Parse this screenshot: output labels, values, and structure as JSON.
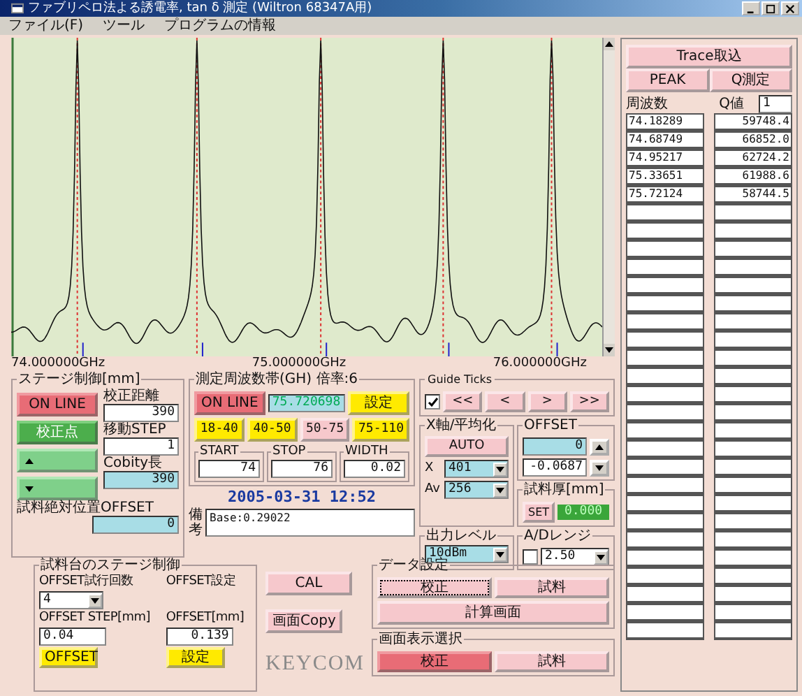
{
  "window": {
    "title": "ファブリペロ法よる誘電率, tan δ 測定 (Wiltron 68347A用)"
  },
  "menu": [
    "ファイル(F)",
    "ツール",
    "プログラムの情報"
  ],
  "chart": {
    "axis_labels": [
      "74.000000GHz",
      "75.000000GHz",
      "76.000000GHz"
    ]
  },
  "stage": {
    "title": "ステージ制御[mm]",
    "online_button": "ON LINE",
    "calib_button": "校正点",
    "fields": [
      {
        "label": "校正距離",
        "value": "390",
        "highlighted": false
      },
      {
        "label": "移動STEP",
        "value": "1",
        "highlighted": false
      },
      {
        "label": "Cobity長",
        "value": "390",
        "highlighted": true
      }
    ],
    "offset_label": "試料絶対位置OFFSET",
    "offset_value": "0"
  },
  "frequency": {
    "title": "測定周波数帯(GH) 倍率:6",
    "online_button": "ON LINE",
    "value": "75.720698",
    "set_button": "設定",
    "bands": [
      {
        "label": "18-40",
        "selected": false
      },
      {
        "label": "40-50",
        "selected": false
      },
      {
        "label": "50-75",
        "selected": true
      },
      {
        "label": "75-110",
        "selected": false
      }
    ],
    "ranges": [
      {
        "label": "START",
        "value": "74"
      },
      {
        "label": "STOP",
        "value": "76"
      },
      {
        "label": "WIDTH",
        "value": "0.02"
      }
    ]
  },
  "timestamp": "2005-03-31  12:52",
  "note": {
    "label": "備考",
    "value": "Base:0.29022"
  },
  "guide_ticks": {
    "title": "Guide Ticks",
    "checked": true,
    "buttons": [
      "<<",
      "<",
      ">",
      ">>"
    ]
  },
  "averaging": {
    "title": "X軸/平均化",
    "auto_button": "AUTO",
    "selects": [
      {
        "label": "X",
        "value": "401"
      },
      {
        "label": "Av",
        "value": "256"
      }
    ]
  },
  "offset": {
    "title": "OFFSET",
    "values": [
      "0",
      "-0.0687"
    ]
  },
  "thickness": {
    "title": "試料厚[mm]",
    "set_button": "SET",
    "value": "0.000"
  },
  "output_level": {
    "title": "出力レベル",
    "value": "10dBm"
  },
  "ad_range": {
    "title": "A/Dレンジ",
    "checked": false,
    "value": "2.50"
  },
  "sample_stage": {
    "title": "試料台のステージ制御",
    "trials_label": "OFFSET試行回数",
    "setting_label": "OFFSET設定",
    "trials_value": "4",
    "step_label": "OFFSET STEP[mm]",
    "step_value": "0.04",
    "offset_label": "OFFSET[mm]",
    "offset_value": "0.139",
    "offset_button": "OFFSET",
    "set_button": "設定"
  },
  "buttons": {
    "cal": "CAL",
    "copy": "画面Copy"
  },
  "logo": "KEYCOM",
  "data_settings": {
    "title": "データ設定",
    "modes": [
      {
        "label": "校正",
        "selected": true
      },
      {
        "label": "試料",
        "selected": false
      }
    ],
    "calc_button": "計算画面"
  },
  "display_select": {
    "title": "画面表示選択",
    "modes": [
      {
        "label": "校正",
        "selected": true
      },
      {
        "label": "試料",
        "selected": false
      }
    ]
  },
  "results": {
    "trace_button": "Trace取込",
    "peak_button": "PEAK",
    "q_button": "Q測定",
    "columns": [
      "周波数",
      "Q値"
    ],
    "q_index": "1",
    "rows": [
      {
        "frequency": "74.18289",
        "q": "59748.4"
      },
      {
        "frequency": "74.68749",
        "q": "66852.0"
      },
      {
        "frequency": "74.95217",
        "q": "62724.2"
      },
      {
        "frequency": "75.33651",
        "q": "61988.6"
      },
      {
        "frequency": "75.72124",
        "q": "58744.5"
      }
    ]
  }
}
